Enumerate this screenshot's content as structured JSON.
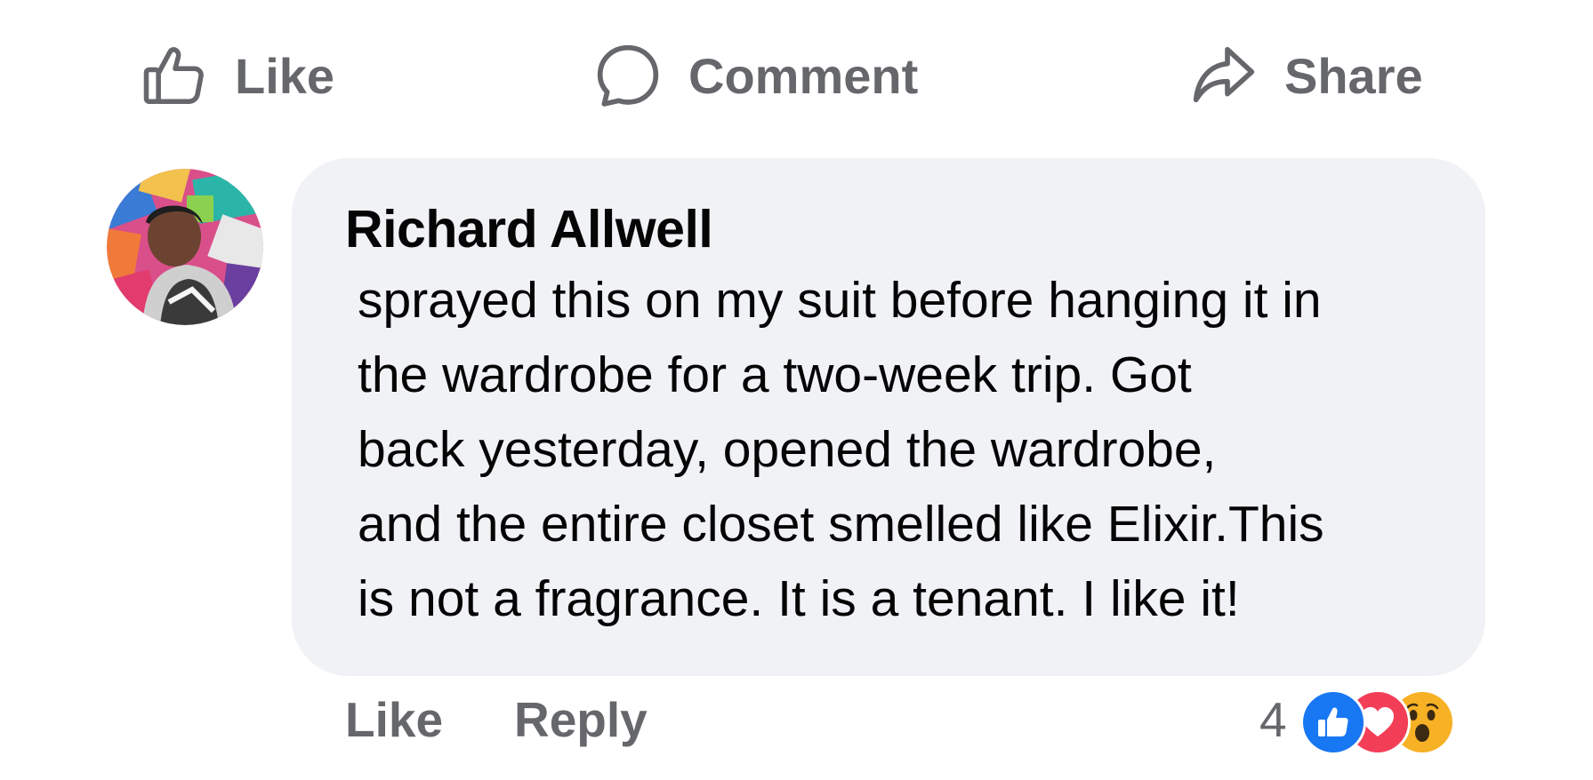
{
  "action_bar": {
    "like_label": "Like",
    "comment_label": "Comment",
    "share_label": "Share"
  },
  "comment": {
    "author": "Richard Allwell",
    "text_lines": [
      "sprayed this on my suit before hanging it in",
      "the wardrobe for a two-week trip. Got",
      "back yesterday, opened the wardrobe,",
      "and the entire closet smelled like Elixir.This",
      "is not a fragrance. It is a tenant. I like it!"
    ],
    "like_label": "Like",
    "reply_label": "Reply",
    "reaction_count": "4",
    "reactions": [
      "like-icon",
      "love-icon",
      "wow-icon"
    ]
  },
  "colors": {
    "bubble_bg": "#f0f2f5",
    "muted_text": "#65676b",
    "like_blue": "#1877f2",
    "love_red": "#f33e58",
    "wow_yellow": "#f7b125"
  }
}
